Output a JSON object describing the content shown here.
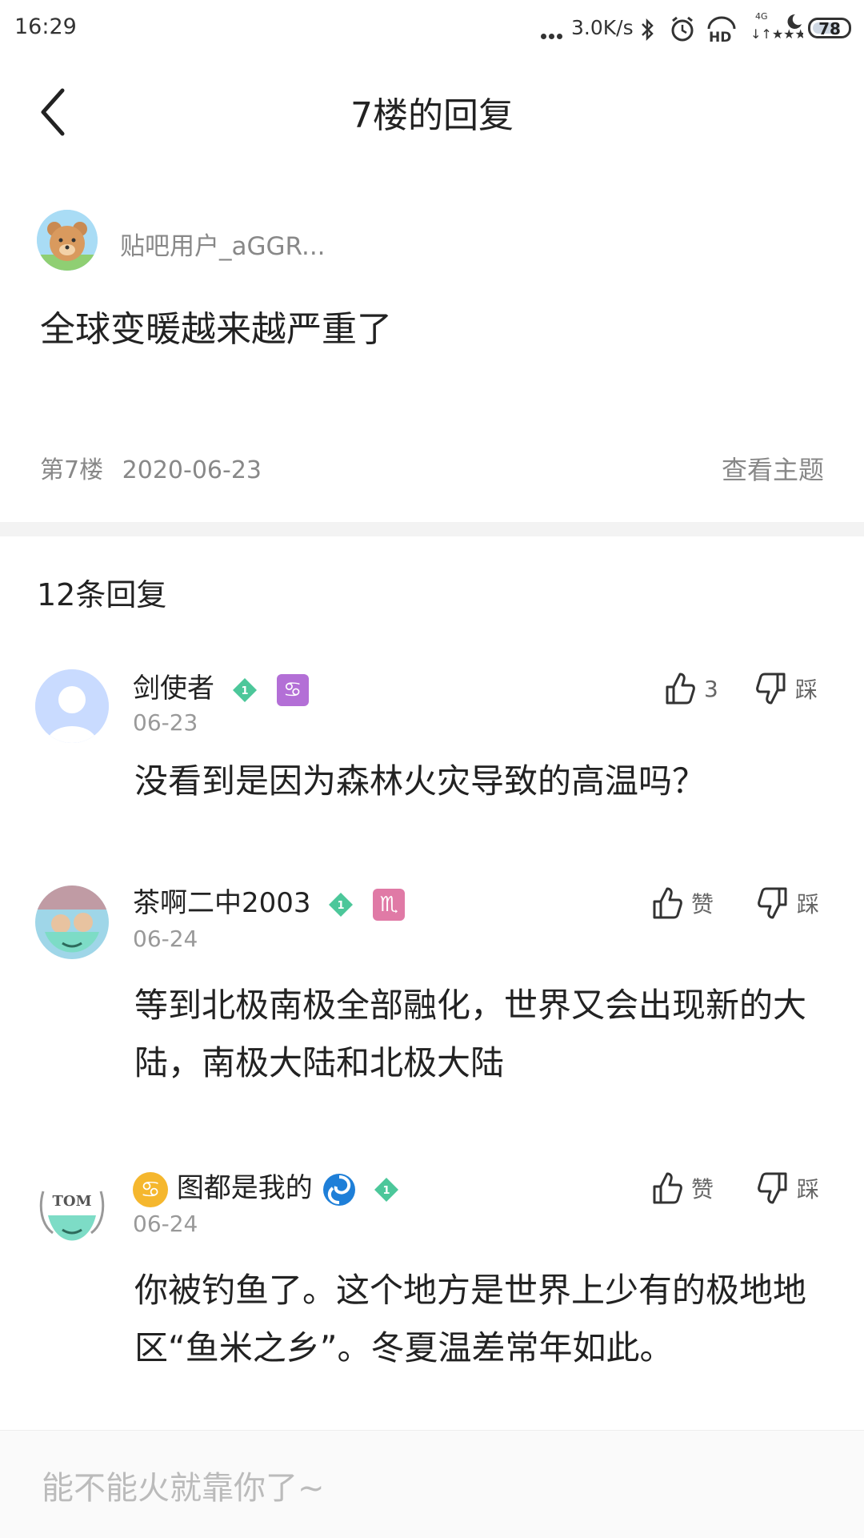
{
  "status_bar": {
    "time": "16:29",
    "net_speed": "3.0K/s",
    "battery": "78",
    "battery_percent": 78
  },
  "header": {
    "title": "7楼的回复"
  },
  "original_post": {
    "username": "贴吧用户_aGGR...",
    "content": "全球变暖越来越严重了",
    "floor": "第7楼",
    "date": "2020-06-23",
    "view_topic": "查看主题"
  },
  "replies_header": {
    "count_label": "12条回复"
  },
  "replies": [
    {
      "username": "剑使者",
      "level": "1",
      "zodiac_glyph": "♋",
      "zodiac_color": "#b36fd6",
      "date": "06-23",
      "like_label": "3",
      "dislike_label": "踩",
      "content": "没看到是因为森林火灾导致的高温吗？"
    },
    {
      "username": "茶啊二中2003",
      "level": "1",
      "zodiac_glyph": "♏",
      "zodiac_color": "#e07aa6",
      "date": "06-24",
      "like_label": "赞",
      "dislike_label": "踩",
      "content": "等到北极南极全部融化，世界又会出现新的大陆，南极大陆和北极大陆"
    },
    {
      "username": "图都是我的",
      "prefix_glyph": "♋",
      "level": "1",
      "date": "06-24",
      "like_label": "赞",
      "dislike_label": "踩",
      "content": "你被钓鱼了。这个地方是世界上少有的极地地区“鱼米之乡”。冬夏温差常年如此。",
      "avatar_text": "TOM"
    }
  ],
  "input": {
    "placeholder": "能不能火就靠你了~"
  },
  "colors": {
    "level_badge": "#4cc79a",
    "muted_text": "#888888"
  }
}
